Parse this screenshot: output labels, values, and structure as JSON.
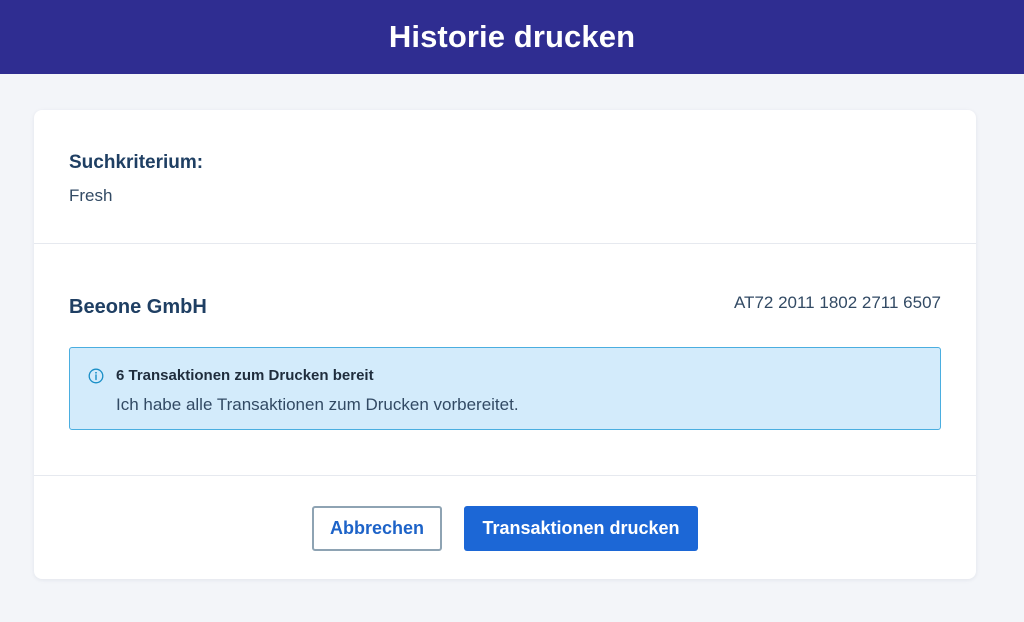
{
  "header": {
    "title": "Historie drucken"
  },
  "criteria": {
    "label": "Suchkriterium:",
    "value": "Fresh"
  },
  "account": {
    "name": "Beeone GmbH",
    "iban": "AT72 2011 1802 2711 6507"
  },
  "info": {
    "icon": "info-circle-icon",
    "title": "6 Transaktionen zum Drucken bereit",
    "text": "Ich habe alle Transaktionen zum Drucken vorbereitet."
  },
  "actions": {
    "cancel_label": "Abbrechen",
    "print_label": "Transaktionen drucken"
  },
  "colors": {
    "header_bg": "#2f2d91",
    "primary": "#1c67d6",
    "info_bg": "#d3ebfb",
    "info_border": "#4aaee0",
    "text_dark": "#1f3f63"
  }
}
